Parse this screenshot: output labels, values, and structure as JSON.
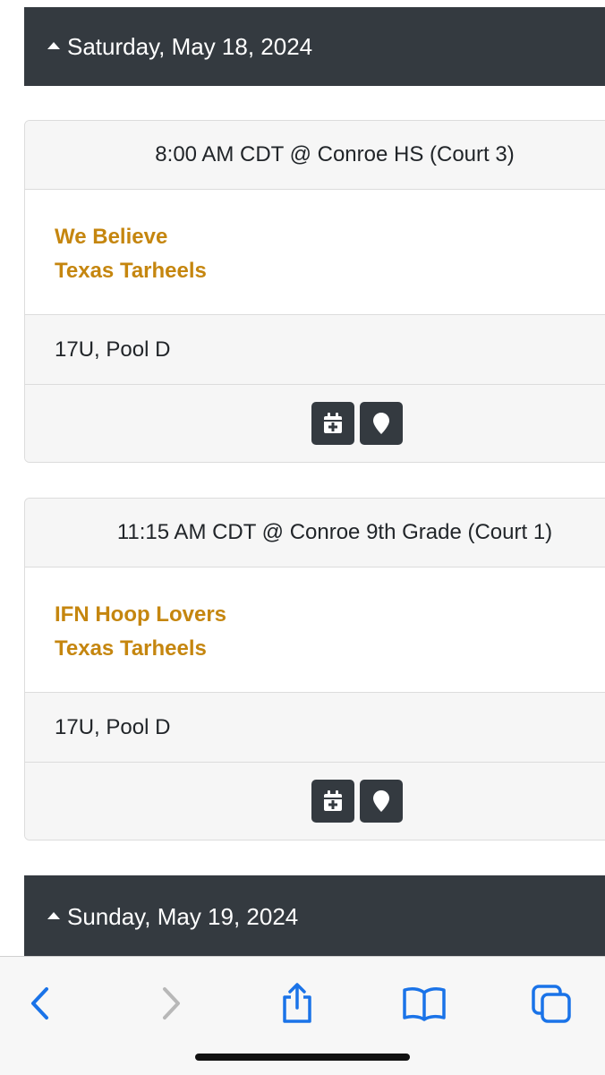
{
  "days": [
    {
      "label": "Saturday, May 18, 2024",
      "games": [
        {
          "time_location": "8:00 AM CDT @ Conroe HS (Court 3)",
          "teams": [
            "We Believe",
            "Texas Tarheels"
          ],
          "division": "17U, Pool D"
        },
        {
          "time_location": "11:15 AM CDT @ Conroe 9th Grade (Court 1)",
          "teams": [
            "IFN Hoop Lovers",
            "Texas Tarheels"
          ],
          "division": "17U, Pool D"
        }
      ]
    },
    {
      "label": "Sunday, May 19, 2024",
      "games": []
    }
  ],
  "icons": {
    "calendar": "calendar-plus-icon",
    "location": "map-marker-icon",
    "back": "chevron-left-icon",
    "forward": "chevron-right-icon",
    "share": "share-icon",
    "bookmarks": "book-icon",
    "tabs": "tabs-icon"
  },
  "colors": {
    "header_bg": "#343a40",
    "team_link": "#c5860f",
    "ios_blue": "#1a73e8"
  }
}
